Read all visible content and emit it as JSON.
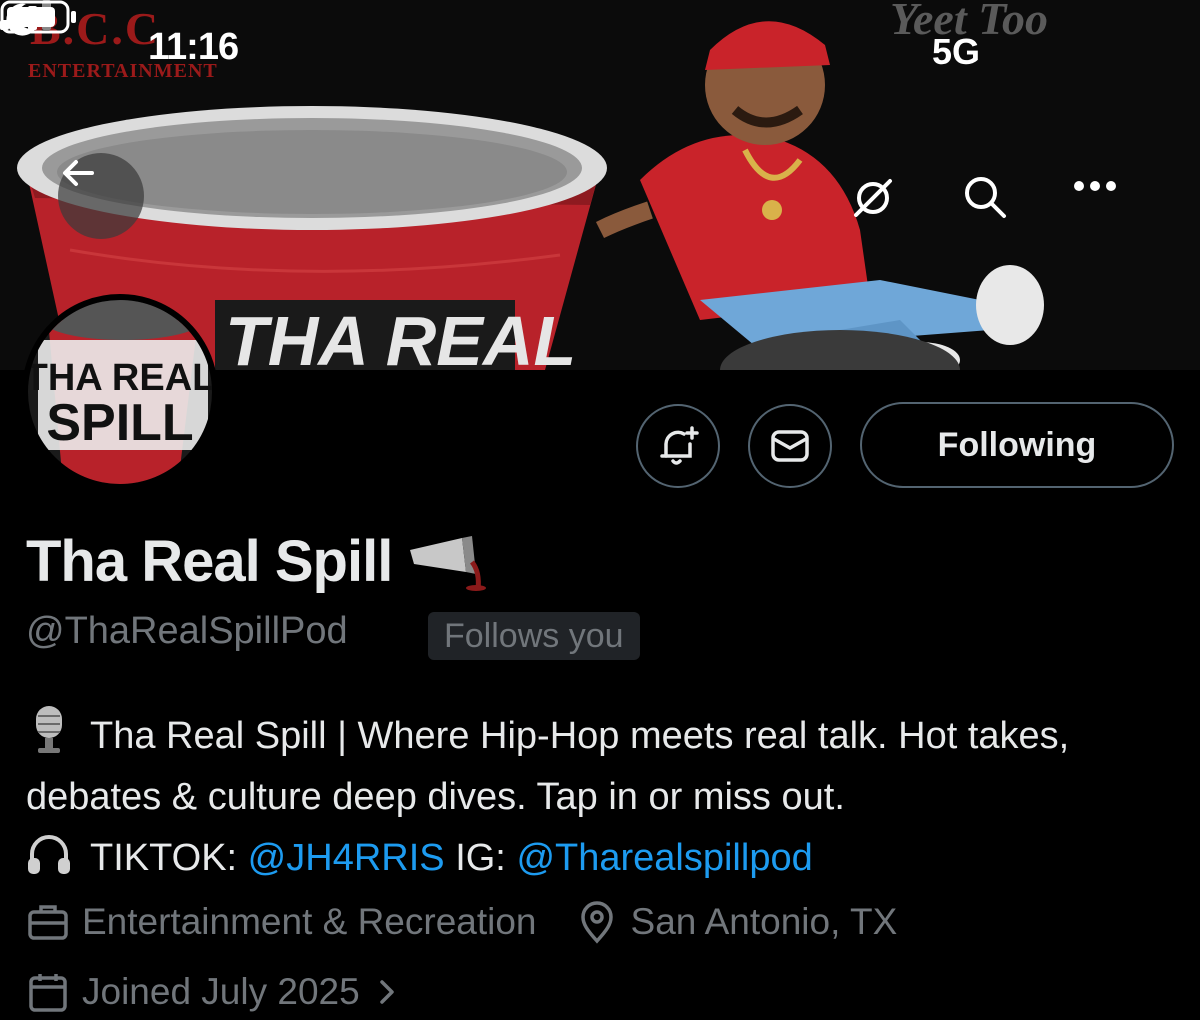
{
  "banner": {
    "logo_left": "B.C.C",
    "logo_left_sub": "ENTERTAINMENT",
    "logo_right": "Yeet Too",
    "cup_text": "THA REAL"
  },
  "status_bar": {
    "time": "11:16",
    "network": "5G"
  },
  "avatar": {
    "line1": "THA REAL",
    "line2": "SPILL"
  },
  "actions": {
    "following_label": "Following"
  },
  "profile": {
    "display_name": "Tha Real Spill",
    "handle": "@ThaRealSpillPod",
    "follows_you": "Follows you",
    "bio": {
      "line1_text": "Tha Real Spill | Where Hip-Hop meets real talk. Hot takes, debates & culture deep dives. Tap in or miss out.",
      "tiktok_label": "TIKTOK:",
      "tiktok_handle": "@JH4RRIS",
      "ig_label": "IG:",
      "ig_handle": "@Tharealspillpod"
    },
    "category": "Entertainment & Recreation",
    "location": "San Antonio, TX",
    "joined": "Joined July 2025"
  },
  "colors": {
    "accent_link": "#1d9bf0",
    "muted_text": "#71767b",
    "primary_text": "#e7e9ea",
    "banner_red": "#c0282a"
  }
}
